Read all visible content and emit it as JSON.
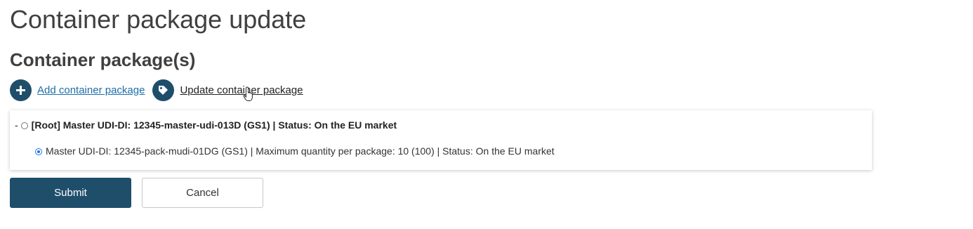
{
  "page": {
    "title": "Container package update",
    "section_title": "Container package(s)"
  },
  "actions": {
    "add_label": "Add container package",
    "update_label": "Update container package"
  },
  "tree": {
    "root": {
      "toggle": "-",
      "label": "[Root] Master UDI-DI: 12345-master-udi-013D (GS1) | Status: On the EU market",
      "selected": false
    },
    "children": [
      {
        "label": "Master UDI-DI: 12345-pack-mudi-01DG (GS1) | Maximum quantity per package: 10 (100) | Status: On the EU market",
        "selected": true
      }
    ]
  },
  "buttons": {
    "submit_label": "Submit",
    "cancel_label": "Cancel"
  },
  "colors": {
    "primary": "#1f4e6b",
    "link": "#1f6ea8",
    "radio_selected": "#1a73e8"
  },
  "icons": {
    "add": "plus-icon",
    "update": "tag-icon",
    "cursor": "hand-pointer-icon"
  }
}
